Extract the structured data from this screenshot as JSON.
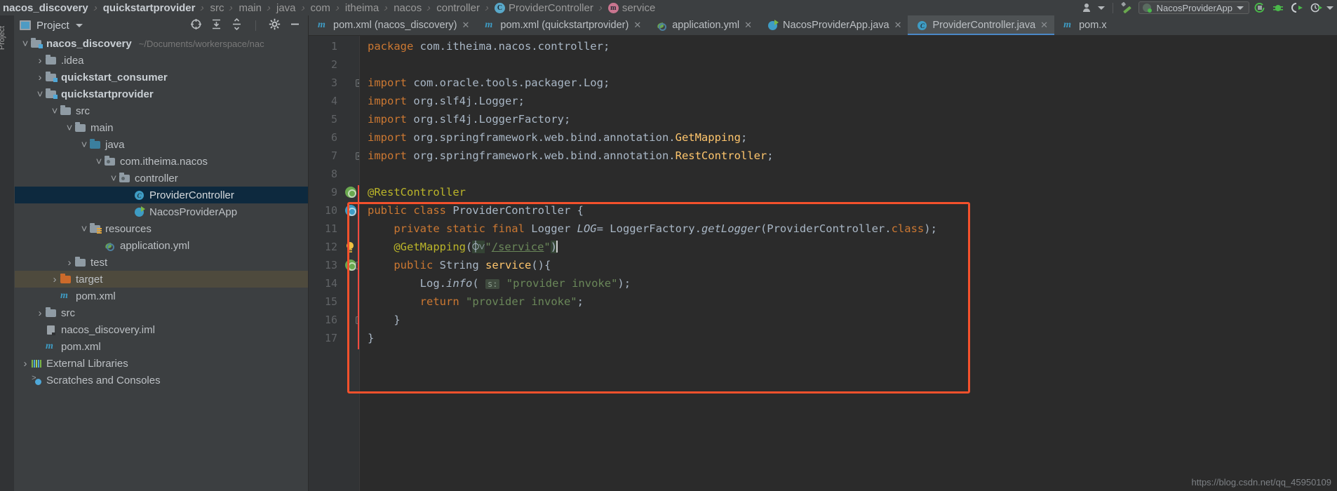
{
  "navbar": {
    "crumbs": [
      {
        "text": "nacos_discovery",
        "bold": true,
        "icon": null
      },
      {
        "text": "quickstartprovider",
        "bold": true,
        "icon": null
      },
      {
        "text": "src",
        "bold": false,
        "icon": null
      },
      {
        "text": "main",
        "bold": false,
        "icon": null
      },
      {
        "text": "java",
        "bold": false,
        "icon": null
      },
      {
        "text": "com",
        "bold": false,
        "icon": null
      },
      {
        "text": "itheima",
        "bold": false,
        "icon": null
      },
      {
        "text": "nacos",
        "bold": false,
        "icon": null
      },
      {
        "text": "controller",
        "bold": false,
        "icon": null
      },
      {
        "text": "ProviderController",
        "bold": false,
        "icon": "C"
      },
      {
        "text": "service",
        "bold": false,
        "icon": "m"
      }
    ],
    "separator": "›",
    "run_config_label": "NacosProviderApp",
    "icons": {
      "user": "user-icon",
      "hammer": "build-icon",
      "run": "run-icon",
      "debug": "debug-icon",
      "run_coverage": "run-with-coverage-icon",
      "profile": "profiler-icon"
    }
  },
  "sidebar": {
    "title": "Project",
    "strip_label": "Project",
    "toolbar": {
      "locate": "locate-icon",
      "expand_all": "expand-all-icon",
      "collapse_all": "collapse-all-icon",
      "settings": "gear-icon",
      "hide": "minimize-icon"
    },
    "tree": [
      {
        "label": "nacos_discovery",
        "note": "~/Documents/workerspace/nac",
        "indent": 0,
        "chev": "v",
        "icon": "module-folder",
        "bold": true,
        "state": "normal"
      },
      {
        "label": ".idea",
        "note": "",
        "indent": 1,
        "chev": ">",
        "icon": "folder",
        "bold": false,
        "state": "normal"
      },
      {
        "label": "quickstart_consumer",
        "note": "",
        "indent": 1,
        "chev": ">",
        "icon": "module-folder",
        "bold": true,
        "state": "normal"
      },
      {
        "label": "quickstartprovider",
        "note": "",
        "indent": 1,
        "chev": "v",
        "icon": "module-folder",
        "bold": true,
        "state": "normal"
      },
      {
        "label": "src",
        "note": "",
        "indent": 2,
        "chev": "v",
        "icon": "folder",
        "bold": false,
        "state": "normal"
      },
      {
        "label": "main",
        "note": "",
        "indent": 3,
        "chev": "v",
        "icon": "folder",
        "bold": false,
        "state": "normal"
      },
      {
        "label": "java",
        "note": "",
        "indent": 4,
        "chev": "v",
        "icon": "source-folder",
        "bold": false,
        "state": "normal"
      },
      {
        "label": "com.itheima.nacos",
        "note": "",
        "indent": 5,
        "chev": "v",
        "icon": "package",
        "bold": false,
        "state": "normal"
      },
      {
        "label": "controller",
        "note": "",
        "indent": 6,
        "chev": "v",
        "icon": "package",
        "bold": false,
        "state": "normal"
      },
      {
        "label": "ProviderController",
        "note": "",
        "indent": 7,
        "chev": "",
        "icon": "java-class",
        "bold": false,
        "state": "selected"
      },
      {
        "label": "NacosProviderApp",
        "note": "",
        "indent": 7,
        "chev": "",
        "icon": "spring-boot-class",
        "bold": false,
        "state": "normal"
      },
      {
        "label": "resources",
        "note": "",
        "indent": 4,
        "chev": "v",
        "icon": "resources-folder",
        "bold": false,
        "state": "normal"
      },
      {
        "label": "application.yml",
        "note": "",
        "indent": 5,
        "chev": "",
        "icon": "yaml-file",
        "bold": false,
        "state": "normal"
      },
      {
        "label": "test",
        "note": "",
        "indent": 3,
        "chev": ">",
        "icon": "folder",
        "bold": false,
        "state": "normal"
      },
      {
        "label": "target",
        "note": "",
        "indent": 2,
        "chev": ">",
        "icon": "excluded-folder",
        "bold": false,
        "state": "highlighted"
      },
      {
        "label": "pom.xml",
        "note": "",
        "indent": 2,
        "chev": "",
        "icon": "maven-file",
        "bold": false,
        "state": "normal"
      },
      {
        "label": "src",
        "note": "",
        "indent": 1,
        "chev": ">",
        "icon": "folder",
        "bold": false,
        "state": "normal"
      },
      {
        "label": "nacos_discovery.iml",
        "note": "",
        "indent": 1,
        "chev": "",
        "icon": "iml-file",
        "bold": false,
        "state": "normal"
      },
      {
        "label": "pom.xml",
        "note": "",
        "indent": 1,
        "chev": "",
        "icon": "maven-file",
        "bold": false,
        "state": "normal"
      },
      {
        "label": "External Libraries",
        "note": "",
        "indent": 0,
        "chev": ">",
        "icon": "external-libraries",
        "bold": false,
        "state": "normal"
      },
      {
        "label": "Scratches and Consoles",
        "note": "",
        "indent": 0,
        "chev": "",
        "icon": "scratches",
        "bold": false,
        "state": "normal"
      }
    ]
  },
  "editor": {
    "tabs": [
      {
        "label": "pom.xml (nacos_discovery)",
        "icon": "maven-file",
        "active": false,
        "closable": true
      },
      {
        "label": "pom.xml (quickstartprovider)",
        "icon": "maven-file",
        "active": false,
        "closable": true
      },
      {
        "label": "application.yml",
        "icon": "yaml-file",
        "active": false,
        "closable": true
      },
      {
        "label": "NacosProviderApp.java",
        "icon": "spring-boot-class",
        "active": false,
        "closable": true
      },
      {
        "label": "ProviderController.java",
        "icon": "java-class",
        "active": true,
        "closable": true
      },
      {
        "label": "pom.x",
        "icon": "maven-file",
        "active": false,
        "closable": false
      }
    ],
    "line_numbers": [
      "1",
      "2",
      "3",
      "4",
      "5",
      "6",
      "7",
      "8",
      "9",
      "10",
      "11",
      "12",
      "13",
      "14",
      "15",
      "16",
      "17"
    ],
    "code_lines": [
      {
        "n": 1,
        "html": "<span class=\"kw\">package</span> com.itheima.nacos.controller;"
      },
      {
        "n": 2,
        "html": ""
      },
      {
        "n": 3,
        "html": "<span class=\"kw\">import</span> com.oracle.tools.packager.Log;"
      },
      {
        "n": 4,
        "html": "<span class=\"kw\">import</span> org.slf4j.Logger;"
      },
      {
        "n": 5,
        "html": "<span class=\"kw\">import</span> org.slf4j.LoggerFactory;"
      },
      {
        "n": 6,
        "html": "<span class=\"kw\">import</span> org.springframework.web.bind.annotation.<span class=\"fn\">GetMapping</span>;"
      },
      {
        "n": 7,
        "html": "<span class=\"kw\">import</span> org.springframework.web.bind.annotation.<span class=\"fn\">RestController</span>;"
      },
      {
        "n": 8,
        "html": ""
      },
      {
        "n": 9,
        "html": "<span class=\"ann\">@RestController</span>"
      },
      {
        "n": 10,
        "html": "<span class=\"kw\">public class</span> ProviderController {"
      },
      {
        "n": 11,
        "html": "    <span class=\"kw\">private static final</span> Logger <span class=\"ital\">LOG</span>= LoggerFactory.<span class=\"ital\">getLogger</span>(ProviderController.<span class=\"kw\">class</span>);"
      },
      {
        "n": 12,
        "html": "    <span class=\"ann\">@GetMapping</span>(<span class=\"sel-hl\">⌽˅</span><span class=\"str\">\"</span><span class=\"urlstr\">/service</span><span class=\"str\">\"</span><span class=\"sel-hl\">)</span><span class=\"caret-bar\"></span>"
      },
      {
        "n": 13,
        "html": "    <span class=\"kw\">public</span> String <span class=\"fn\">service</span>(){"
      },
      {
        "n": 14,
        "html": "        Log.<span class=\"ital\">info</span>( <span class=\"param-hint\">s:</span> <span class=\"str\">\"provider invoke\"</span>);"
      },
      {
        "n": 15,
        "html": "        <span class=\"kw\">return</span> <span class=\"str\">\"provider invoke\"</span>;"
      },
      {
        "n": 16,
        "html": "    }"
      },
      {
        "n": 17,
        "html": "}"
      }
    ],
    "annotation_box_color": "#f4512c",
    "watermark": "https://blog.csdn.net/qq_45950109"
  }
}
